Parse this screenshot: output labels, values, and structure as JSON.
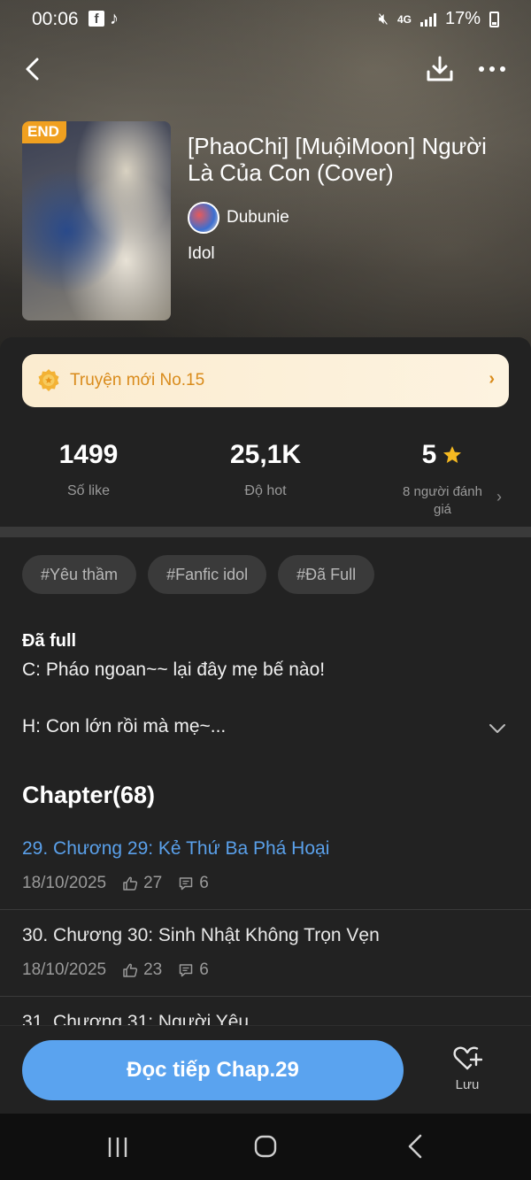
{
  "status_bar": {
    "time": "00:06",
    "fb_label": "f",
    "tiktok_label": "♪",
    "network": "4G",
    "battery": "17%"
  },
  "story": {
    "badge": "END",
    "title": "[PhaoChi] [MuộiMoon] Người Là Của Con (Cover)",
    "author": "Dubunie",
    "category": "Idol"
  },
  "rank_banner": {
    "text": "Truyện mới No.15",
    "arrow": "›"
  },
  "stats": {
    "likes_value": "1499",
    "likes_label": "Số like",
    "hot_value": "25,1K",
    "hot_label": "Độ hot",
    "rating_value": "5",
    "rating_label": "8 người đánh giá",
    "rating_arrow": "›"
  },
  "tags": [
    "#Yêu thầm",
    "#Fanfic idol",
    "#Đã Full"
  ],
  "description": {
    "status": "Đã full",
    "line1": "C: Pháo ngoan~~ lại đây mẹ bế nào!",
    "line2": "H: Con lớn rồi mà mẹ~..."
  },
  "chapters": {
    "heading": "Chapter(68)",
    "items": [
      {
        "title": "29. Chương 29: Kẻ Thứ Ba Phá Hoại",
        "date": "18/10/2025",
        "likes": "27",
        "comments": "6"
      },
      {
        "title": "30. Chương 30: Sinh Nhật Không Trọn Vẹn",
        "date": "18/10/2025",
        "likes": "23",
        "comments": "6"
      },
      {
        "title": "31. Chương 31: Người Yêu",
        "date": "",
        "likes": "",
        "comments": ""
      }
    ]
  },
  "bottom_bar": {
    "read_label": "Đọc tiếp Chap.29",
    "save_label": "Lưu"
  },
  "colors": {
    "accent_blue": "#5aa3ef",
    "rank_orange": "#d98b1b",
    "badge_orange": "#f0a020",
    "background": "#222222"
  },
  "icons": [
    "back-icon",
    "download-icon",
    "more-icon",
    "medal-icon",
    "star-icon",
    "chevron-down-icon",
    "like-icon",
    "comment-icon",
    "heart-plus-icon",
    "recents-icon",
    "home-icon",
    "nav-back-icon"
  ]
}
